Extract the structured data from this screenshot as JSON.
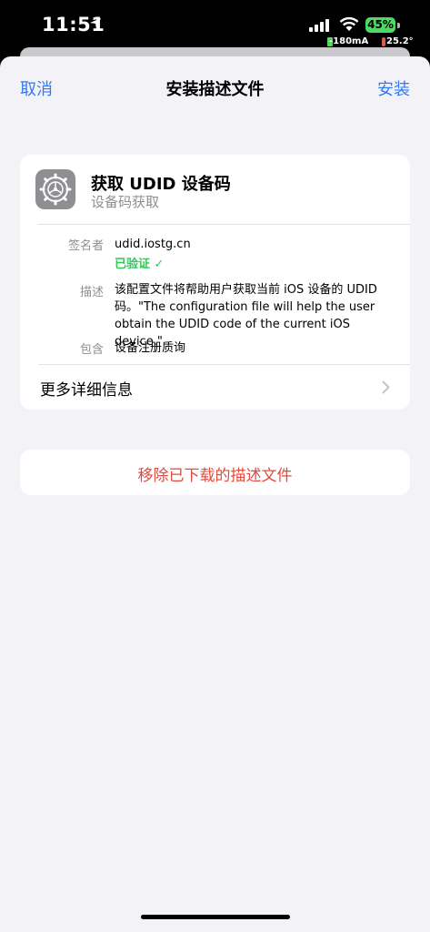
{
  "status_bar": {
    "time": "11:51",
    "battery": "45%",
    "current": "-180mA",
    "temperature": "25.2°",
    "location_icon": "location-arrow-icon",
    "signal_icon": "cellular-signal-icon",
    "wifi_icon": "wifi-icon"
  },
  "nav": {
    "cancel": "取消",
    "title": "安装描述文件",
    "install": "安装"
  },
  "profile": {
    "icon": "settings-gear-icon",
    "name": "获取 UDID 设备码",
    "subtitle": "设备码获取",
    "signer_label": "签名者",
    "signer_value": "udid.iostg.cn",
    "verified_label": "已验证 ✓",
    "description_label": "描述",
    "description_value": "该配置文件将帮助用户获取当前 iOS 设备的 UDID 码。\"The configuration file will help the user obtain the UDID code of the current iOS device.\"",
    "contains_label": "包含",
    "contains_value": "设备注册质询",
    "more_details": "更多详细信息"
  },
  "remove_button": "移除已下载的描述文件",
  "colors": {
    "accent": "#3478f6",
    "verified": "#34c759",
    "destructive": "#e5493c",
    "background": "#f2f2f7",
    "battery": "#4cd964"
  }
}
